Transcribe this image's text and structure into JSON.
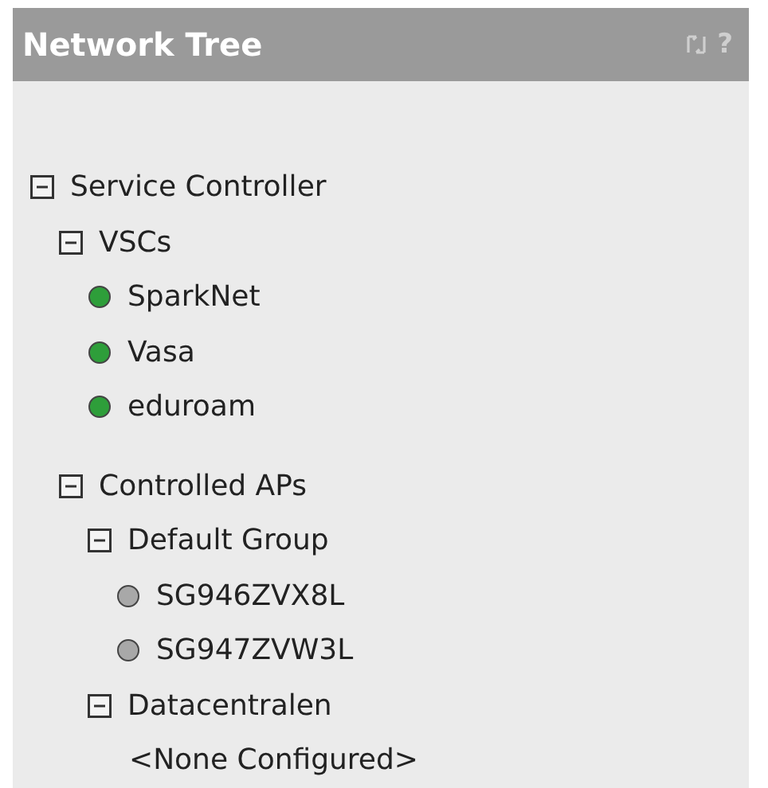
{
  "panel": {
    "title": "Network Tree",
    "help": "?"
  },
  "tree": [
    {
      "kind": "folder",
      "label": "Service Controller",
      "expanded": true,
      "children": [
        {
          "kind": "folder",
          "label": "VSCs",
          "expanded": true,
          "children": [
            {
              "kind": "device",
              "label": "SparkNet",
              "color": "#2e9e3a"
            },
            {
              "kind": "device",
              "label": "Vasa",
              "color": "#2e9e3a"
            },
            {
              "kind": "device",
              "label": "eduroam",
              "color": "#2e9e3a"
            }
          ]
        },
        {
          "kind": "folder",
          "label": "Controlled APs",
          "expanded": true,
          "children": [
            {
              "kind": "folder",
              "label": "Default Group",
              "expanded": true,
              "children": [
                {
                  "kind": "device",
                  "label": "SG946ZVX8L",
                  "color": "#a8a8a8"
                },
                {
                  "kind": "device",
                  "label": "SG947ZVW3L",
                  "color": "#a8a8a8"
                }
              ]
            },
            {
              "kind": "folder",
              "label": "Datacentralen",
              "expanded": true,
              "children": [
                {
                  "kind": "note",
                  "label": "<None Configured>"
                }
              ]
            }
          ]
        }
      ]
    }
  ]
}
